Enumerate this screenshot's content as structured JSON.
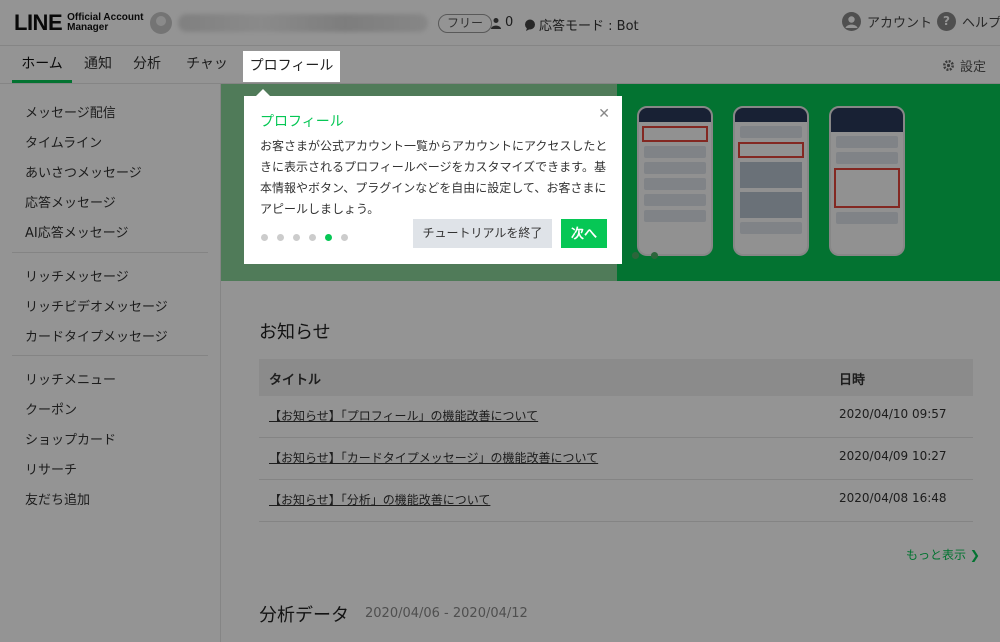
{
  "header": {
    "logo_main": "LINE",
    "logo_sub_1": "Official Account",
    "logo_sub_2": "Manager",
    "plan_badge": "フリー",
    "friends_count": "0",
    "response_mode": "応答モード : Bot",
    "account_label": "アカウント",
    "help_label": "ヘルプ"
  },
  "tabs": [
    {
      "label": "ホーム"
    },
    {
      "label": "通知"
    },
    {
      "label": "分析"
    },
    {
      "label": "チャット"
    },
    {
      "label": "プロフィール"
    }
  ],
  "settings_label": "設定",
  "sidebar": {
    "items": [
      "メッセージ配信",
      "タイムライン",
      "あいさつメッセージ",
      "応答メッセージ",
      "AI応答メッセージ",
      "リッチメッセージ",
      "リッチビデオメッセージ",
      "カードタイプメッセージ",
      "リッチメニュー",
      "クーポン",
      "ショップカード",
      "リサーチ",
      "友だち追加"
    ]
  },
  "news": {
    "title": "お知らせ",
    "col_title": "タイトル",
    "col_date": "日時",
    "rows": [
      {
        "title": "【お知らせ】「プロフィール」の機能改善について",
        "date": "2020/04/10 09:57"
      },
      {
        "title": "【お知らせ】「カードタイプメッセージ」の機能改善について",
        "date": "2020/04/09 10:27"
      },
      {
        "title": "【お知らせ】「分析」の機能改善について",
        "date": "2020/04/08 16:48"
      }
    ],
    "more": "もっと表示 ❯"
  },
  "analytics": {
    "title": "分析データ",
    "range": "2020/04/06 - 2020/04/12"
  },
  "tutorial": {
    "title": "プロフィール",
    "body": "お客さまが公式アカウント一覧からアカウントにアクセスしたときに表示されるプロフィールページをカスタマイズできます。基本情報やボタン、プラグインなどを自由に設定して、お客さまにアピールしましょう。",
    "end_button": "チュートリアルを終了",
    "next_button": "次へ",
    "step_count": 6,
    "active_step": 5
  },
  "colors": {
    "accent": "#06c755"
  }
}
